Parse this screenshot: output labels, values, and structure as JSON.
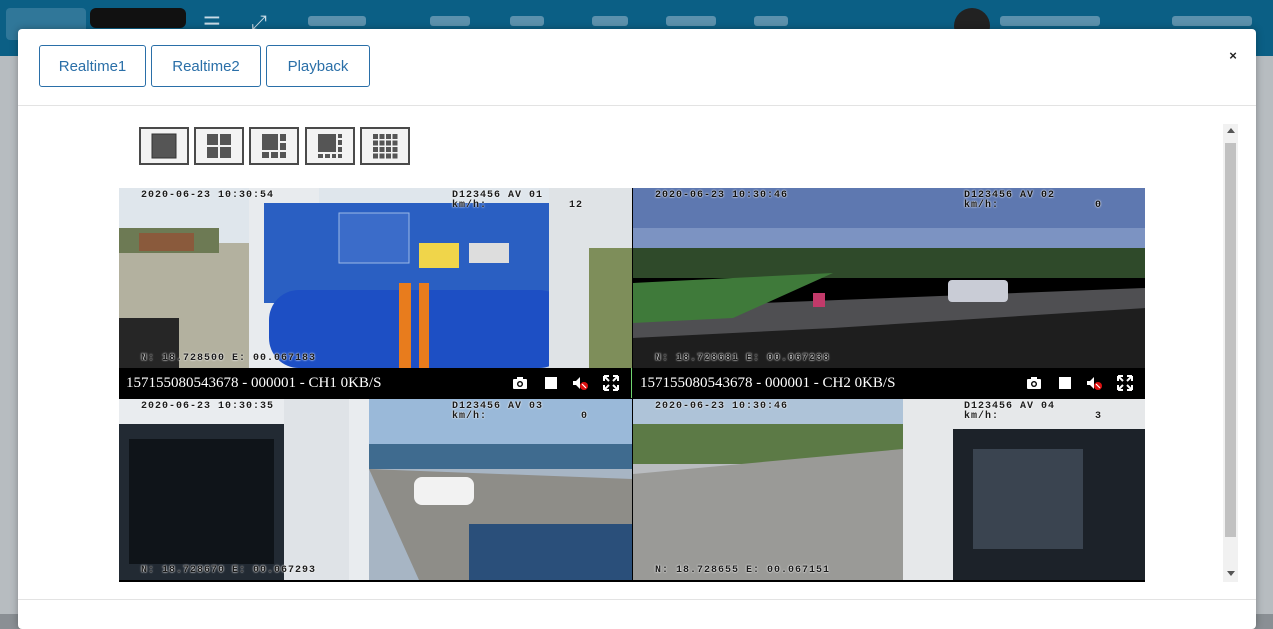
{
  "tabs": [
    {
      "label": "Realtime1"
    },
    {
      "label": "Realtime2"
    },
    {
      "label": "Playback"
    }
  ],
  "close_label": "×",
  "layouts": [
    "layout-1",
    "layout-4",
    "layout-6",
    "layout-8",
    "layout-16"
  ],
  "cameras": [
    {
      "date": "2020-06-23 10:30:54",
      "device": "D123456 AV 01",
      "speed_label": "km/h:",
      "speed": "12",
      "gps": "N: 18.728500 E: 00.067183",
      "status": "157155080543678 - 000001 - CH1 0KB/S"
    },
    {
      "date": "2020-06-23 10:30:46",
      "device": "D123456 AV 02",
      "speed_label": "km/h:",
      "speed": "0",
      "gps": "N: 18.728681 E: 00.067238",
      "status": "157155080543678 - 000001 - CH2 0KB/S"
    },
    {
      "date": "2020-06-23 10:30:35",
      "device": "D123456 AV 03",
      "speed_label": "km/h:",
      "speed": "0",
      "gps": "N: 18.728670 E: 00.067293"
    },
    {
      "date": "2020-06-23 10:30:46",
      "device": "D123456 AV 04",
      "speed_label": "km/h:",
      "speed": "3",
      "gps": "N: 18.728655 E: 00.067151"
    }
  ],
  "colors": {
    "accent": "#2a6fa8",
    "topbar": "#0b5f85",
    "active_cell_border": "#6fd46f"
  }
}
